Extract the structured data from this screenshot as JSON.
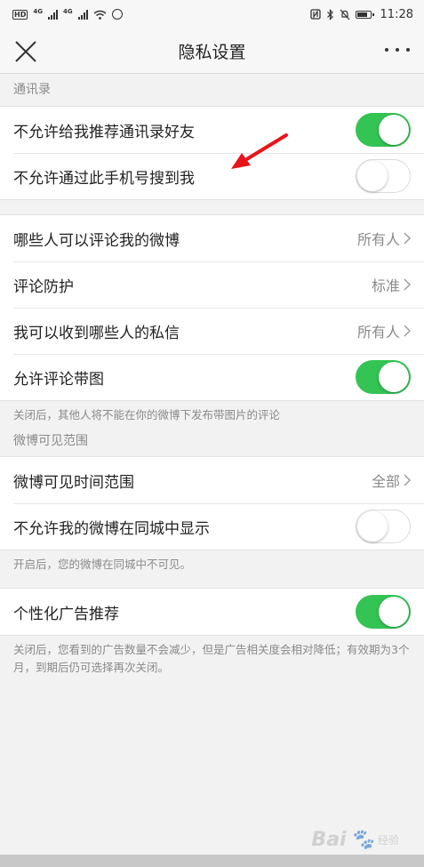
{
  "status_bar": {
    "hd_tag": "HD",
    "net_tag_1": "4G",
    "net_tag_2": "4G",
    "time": "11:28"
  },
  "nav": {
    "title": "隐私设置",
    "close_icon": "close-icon",
    "more_icon": "more-icon"
  },
  "contacts_section": {
    "header": "通讯录",
    "rows": [
      {
        "label": "不允许给我推荐通讯录好友",
        "toggle": true
      },
      {
        "label": "不允许通过此手机号搜到我",
        "toggle": false
      }
    ]
  },
  "comments_group": {
    "rows": [
      {
        "label": "哪些人可以评论我的微博",
        "value": "所有人"
      },
      {
        "label": "评论防护",
        "value": "标准"
      },
      {
        "label": "我可以收到哪些人的私信",
        "value": "所有人"
      },
      {
        "label": "允许评论带图",
        "toggle": true
      }
    ],
    "note": "关闭后，其他人将不能在你的微博下发布带图片的评论"
  },
  "visibility_section": {
    "header": "微博可见范围",
    "rows": [
      {
        "label": "微博可见时间范围",
        "value": "全部"
      },
      {
        "label": "不允许我的微博在同城中显示",
        "toggle": false
      }
    ],
    "note": "开启后，您的微博在同城中不可见。"
  },
  "ads_group": {
    "rows": [
      {
        "label": "个性化广告推荐",
        "toggle": true
      }
    ],
    "note": "关闭后，您看到的广告数量不会减少，但是广告相关度会相对降低；有效期为3个月，到期后仍可选择再次关闭。"
  },
  "watermark": {
    "brand": "Bai",
    "suffix": "经验"
  },
  "colors": {
    "toggle_on": "#33c454",
    "annotation_arrow": "#e8141c",
    "section_text": "#8a8a8a"
  }
}
